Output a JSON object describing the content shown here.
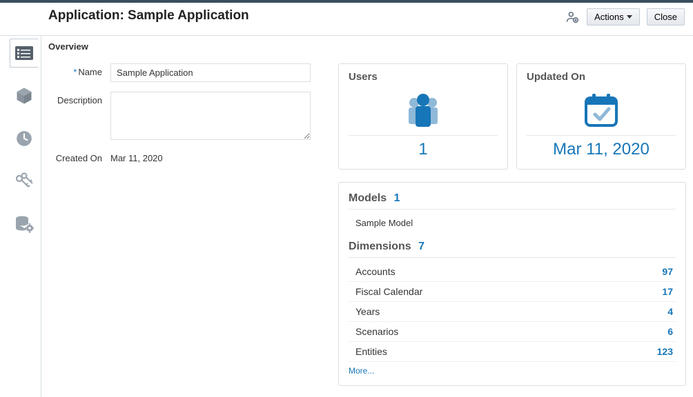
{
  "header": {
    "title": "Application: Sample Application",
    "subtitle": "Overview",
    "actions_label": "Actions",
    "close_label": "Close"
  },
  "sidebar": {
    "items": [
      {
        "name": "overview",
        "icon": "list-icon"
      },
      {
        "name": "model",
        "icon": "cube-icon"
      },
      {
        "name": "history",
        "icon": "clock-icon"
      },
      {
        "name": "permissions",
        "icon": "keys-icon"
      },
      {
        "name": "settings-db",
        "icon": "db-gear-icon"
      }
    ]
  },
  "form": {
    "name_label": "Name",
    "name_value": "Sample Application",
    "description_label": "Description",
    "description_value": "",
    "created_on_label": "Created On",
    "created_on_value": "Mar 11, 2020"
  },
  "users_card": {
    "title": "Users",
    "count": "1"
  },
  "updated_card": {
    "title": "Updated On",
    "date": "Mar 11, 2020"
  },
  "models": {
    "heading": "Models",
    "count": "1",
    "items": [
      {
        "name": "Sample Model"
      }
    ]
  },
  "dimensions": {
    "heading": "Dimensions",
    "count": "7",
    "items": [
      {
        "label": "Accounts",
        "value": "97"
      },
      {
        "label": "Fiscal Calendar",
        "value": "17"
      },
      {
        "label": "Years",
        "value": "4"
      },
      {
        "label": "Scenarios",
        "value": "6"
      },
      {
        "label": "Entities",
        "value": "123"
      }
    ],
    "more_label": "More..."
  }
}
